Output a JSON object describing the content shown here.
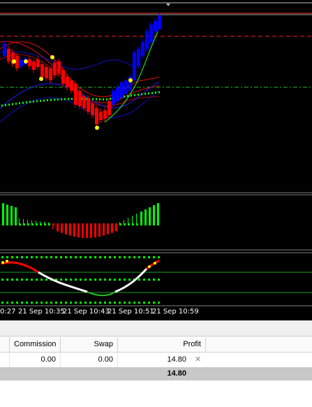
{
  "chart": {
    "time_axis": [
      "0:27",
      "21 Sep 10:35",
      "21 Sep 10:43",
      "21 Sep 10:51",
      "21 Sep 10:59"
    ],
    "colors": {
      "background": "#000000",
      "bull_candle": "#0000ff",
      "bear_candle": "#ff0000",
      "histogram_up": "#00ff00",
      "histogram_down": "#ff0000",
      "fractal": "#ffff00"
    }
  },
  "trade_table": {
    "columns": {
      "commission": "Commission",
      "swap": "Swap",
      "profit": "Profit"
    },
    "row": {
      "commission": "0.00",
      "swap": "0.00",
      "profit": "14.80"
    },
    "total": {
      "profit": "14.80"
    }
  }
}
